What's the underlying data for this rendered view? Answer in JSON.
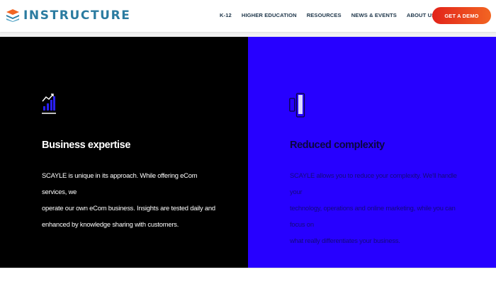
{
  "header": {
    "logo_text": "INSTRUCTURE",
    "nav": [
      "K-12",
      "HIGHER EDUCATION",
      "RESOURCES",
      "NEWS & EVENTS",
      "ABOUT US"
    ],
    "cta_label": "GET A DEMO"
  },
  "features": [
    {
      "icon": "bar-chart-icon",
      "title": "Business expertise",
      "lines": [
        "SCAYLE is unique in its approach. While offering eCom services, we",
        "operate our own eCom business. Insights are tested daily and",
        "enhanced by knowledge sharing with customers."
      ]
    },
    {
      "icon": "devices-icon",
      "title": "Reduced complexity",
      "lines": [
        "SCAYLE allows you to reduce your complexity. We'll handle your",
        "technology, operations and online marketing, while you can focus on",
        "what really differentiates your business."
      ]
    }
  ],
  "colors": {
    "brand": "#2a7ba0",
    "cta_gradient_start": "#e2231a",
    "cta_gradient_end": "#f26522",
    "panel_left": "#000000",
    "panel_right": "#2700ff"
  }
}
